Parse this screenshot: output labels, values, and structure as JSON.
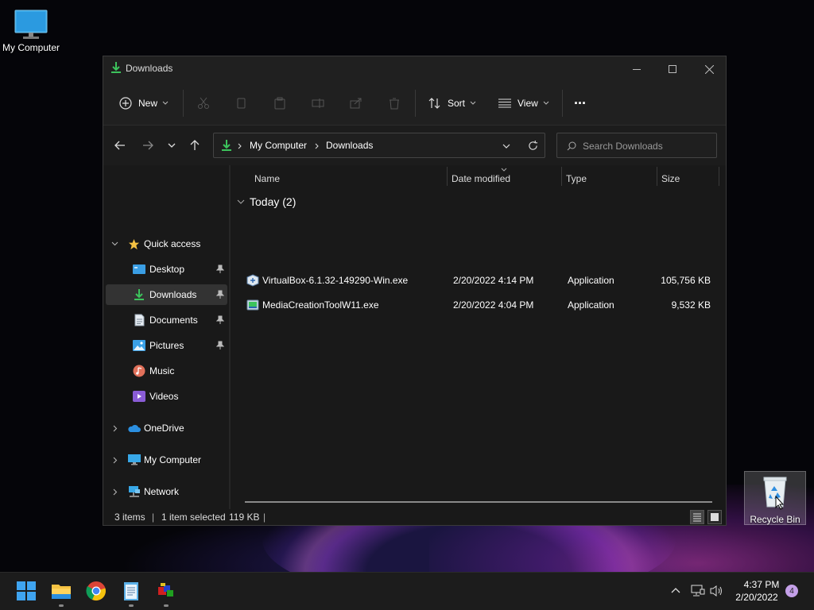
{
  "desktop": {
    "my_computer_label": "My Computer",
    "recycle_bin_label": "Recycle Bin"
  },
  "window": {
    "title": "Downloads",
    "toolbar": {
      "new_label": "New",
      "sort_label": "Sort",
      "view_label": "View",
      "more_label": "···"
    },
    "address": {
      "segments": [
        "My Computer",
        "Downloads"
      ]
    },
    "search": {
      "placeholder": "Search Downloads"
    },
    "sidebar": {
      "quick_access": "Quick access",
      "items": [
        {
          "label": "Desktop",
          "pinned": true
        },
        {
          "label": "Downloads",
          "pinned": true,
          "selected": true
        },
        {
          "label": "Documents",
          "pinned": true
        },
        {
          "label": "Pictures",
          "pinned": true
        },
        {
          "label": "Music",
          "pinned": false
        },
        {
          "label": "Videos",
          "pinned": false
        }
      ],
      "onedrive": "OneDrive",
      "my_computer": "My Computer",
      "network": "Network"
    },
    "columns": {
      "name": "Name",
      "date": "Date modified",
      "type": "Type",
      "size": "Size"
    },
    "group_label": "Today (2)",
    "files": [
      {
        "name": "VirtualBox-6.1.32-149290-Win.exe",
        "date": "2/20/2022 4:14 PM",
        "type": "Application",
        "size": "105,756 KB"
      },
      {
        "name": "MediaCreationToolW11.exe",
        "date": "2/20/2022 4:04 PM",
        "type": "Application",
        "size": "9,532 KB"
      }
    ],
    "status": {
      "items": "3 items",
      "selected": "1 item selected",
      "size": "119 KB"
    }
  },
  "taskbar": {
    "time": "4:37 PM",
    "date": "2/20/2022",
    "notification_count": "4"
  },
  "colors": {
    "accent_green": "#3cc35c",
    "folder_yellow": "#f5c242",
    "selection": "#333333"
  }
}
